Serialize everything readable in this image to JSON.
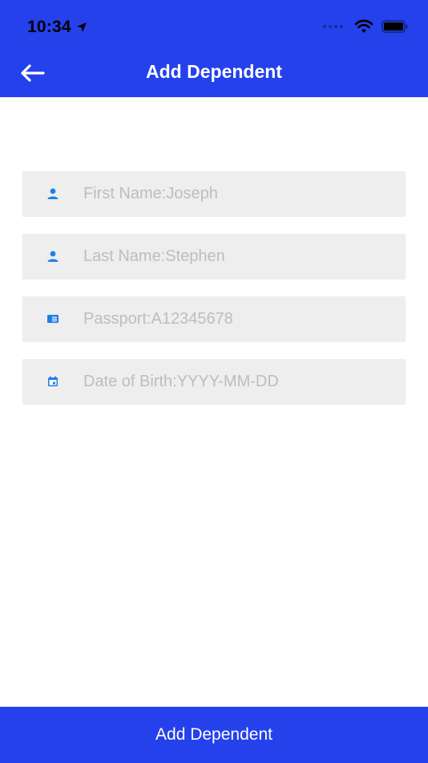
{
  "status_bar": {
    "time": "10:34"
  },
  "nav": {
    "title": "Add Dependent"
  },
  "form": {
    "fields": [
      {
        "icon": "person-icon",
        "placeholder": "First Name:Joseph",
        "value": ""
      },
      {
        "icon": "person-icon",
        "placeholder": "Last Name:Stephen",
        "value": ""
      },
      {
        "icon": "passport-icon",
        "placeholder": "Passport:A12345678",
        "value": ""
      },
      {
        "icon": "calendar-icon",
        "placeholder": "Date of Birth:YYYY-MM-DD",
        "value": ""
      }
    ]
  },
  "footer": {
    "button_label": "Add Dependent"
  },
  "colors": {
    "brand_blue": "#2441EB",
    "icon_blue": "#1E7FE8",
    "field_bg": "#EEEEEE",
    "placeholder": "#BDBDBD"
  }
}
